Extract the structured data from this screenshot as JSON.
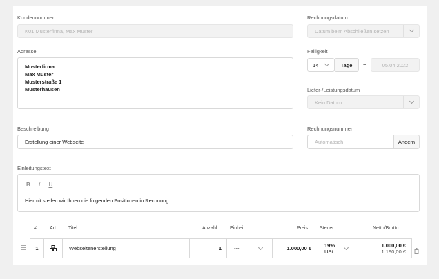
{
  "customer": {
    "label": "Kundennummer",
    "placeholder": "K01 Musterfirma, Max Muster"
  },
  "invoice_date": {
    "label": "Rechnungsdatum",
    "placeholder": "Datum beim Abschließen setzen"
  },
  "address": {
    "label": "Adresse",
    "lines": [
      "Musterfirma",
      "Max Muster",
      "Musterstraße 1",
      "Musterhausen"
    ]
  },
  "due": {
    "label": "Fälligkeit",
    "days": "14",
    "unit": "Tage",
    "equals": "=",
    "date": "05.04.2022"
  },
  "delivery_date": {
    "label": "Liefer-/Leistungsdatum",
    "placeholder": "Kein Datum"
  },
  "description": {
    "label": "Beschreibung",
    "value": "Erstellung einer Webseite"
  },
  "invoice_number": {
    "label": "Rechnungsnummer",
    "placeholder": "Automatisch",
    "change_button": "Ändern"
  },
  "intro": {
    "label": "Einleitungstext",
    "bold": "B",
    "italic": "I",
    "underline": "U",
    "text": "Hiermit stellen wir Ihnen die folgenden Positionen in Rechnung."
  },
  "table": {
    "headers": {
      "num": "#",
      "type": "Art",
      "title": "Titel",
      "qty": "Anzahl",
      "unit": "Einheit",
      "price": "Preis",
      "tax": "Steuer",
      "net_gross": "Netto/Brutto"
    },
    "rows": [
      {
        "num": "1",
        "type_icon": "items-icon",
        "title": "Webseitenerstellung",
        "qty": "1",
        "unit": "---",
        "price": "1.000,00 €",
        "tax_rate": "19%",
        "tax_label": "USt",
        "net": "1.000,00 €",
        "gross": "1.190,00 €"
      }
    ]
  }
}
